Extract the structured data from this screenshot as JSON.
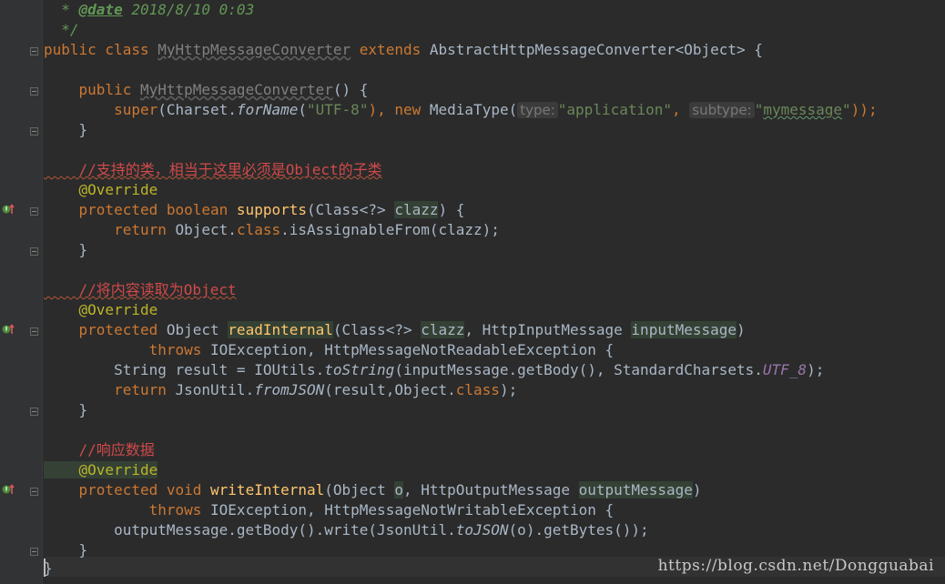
{
  "editor": {
    "lines": {
      "l1_a": "  * ",
      "l1_tag": "@date",
      "l1_b": " 2018/8/10 0:03",
      "l2": "  */",
      "l3_kw": "public class ",
      "l3_cls": "MyHttpMessageConverter",
      "l3_ext": " extends ",
      "l3_rest": "AbstractHttpMessageConverter<Object> {",
      "l5_kw": "    public ",
      "l5_ctor": "MyHttpMessageConverter",
      "l5_rest": "() {",
      "l6_super": "        super",
      "l6_a": "(Charset.",
      "l6_forname": "forName",
      "l6_b": "(",
      "l6_utf": "\"UTF-8\"",
      "l6_c": "), ",
      "l6_new": "new ",
      "l6_d": "MediaType(",
      "l6_hint1": "type:",
      "l6_app": "\"application\"",
      "l6_e": ", ",
      "l6_hint2": "subtype:",
      "l6_my_q1": "\"",
      "l6_my": "mymessage",
      "l6_my_q2": "\"",
      "l6_f": "));",
      "l7": "    }",
      "l9": "    //支持的类，相当于这里必须是Object的子类",
      "l10": "    @Override",
      "l11_kw": "    protected boolean ",
      "l11_fn": "supports",
      "l11_a": "(Class<?> ",
      "l11_p": "clazz",
      "l11_b": ") {",
      "l12_kw": "        return ",
      "l12_a": "Object.",
      "l12_cls": "class",
      "l12_b": ".isAssignableFrom(clazz);",
      "l13": "    }",
      "l15": "    //将内容读取为Object",
      "l16": "    @Override",
      "l17_kw": "    protected ",
      "l17_a": "Object ",
      "l17_fn": "readInternal",
      "l17_b": "(Class<?> ",
      "l17_p1": "clazz",
      "l17_c": ", HttpInputMessage ",
      "l17_p2": "inputMessage",
      "l17_d": ")",
      "l18_kw": "            throws ",
      "l18_a": "IOException, HttpMessageNotReadableException {",
      "l19_a": "        String result = IOUtils.",
      "l19_ts": "toString",
      "l19_b": "(inputMessage.getBody(), StandardCharsets.",
      "l19_f": "UTF_8",
      "l19_c": ");",
      "l20_kw": "        return ",
      "l20_a": "JsonUtil.",
      "l20_fj": "fromJSON",
      "l20_b": "(result,Object.",
      "l20_cls": "class",
      "l20_c": ");",
      "l21": "    }",
      "l23": "    //响应数据",
      "l24": "    @Override",
      "l25_kw": "    protected void ",
      "l25_fn": "writeInternal",
      "l25_a": "(Object ",
      "l25_p1": "o",
      "l25_b": ", HttpOutputMessage ",
      "l25_p2": "outputMessage",
      "l25_c": ")",
      "l26_kw": "            throws ",
      "l26_a": "IOException, HttpMessageNotWritableException {",
      "l27_a": "        outputMessage.getBody().write(JsonUtil.",
      "l27_tj": "toJSON",
      "l27_b": "(o).getBytes());",
      "l28": "    }",
      "l29": "}"
    }
  },
  "watermark": "https://blog.csdn.net/Dongguabai",
  "icons": {
    "override_gutter": "override-method-icon",
    "fold": "fold-marker-icon"
  },
  "colors": {
    "background": "#2b2b2b",
    "gutter": "#313335",
    "keyword": "#cc7832",
    "string": "#6a8759",
    "annotation": "#bbb529",
    "method": "#ffc66d",
    "comment_cn": "#d04a4a"
  }
}
